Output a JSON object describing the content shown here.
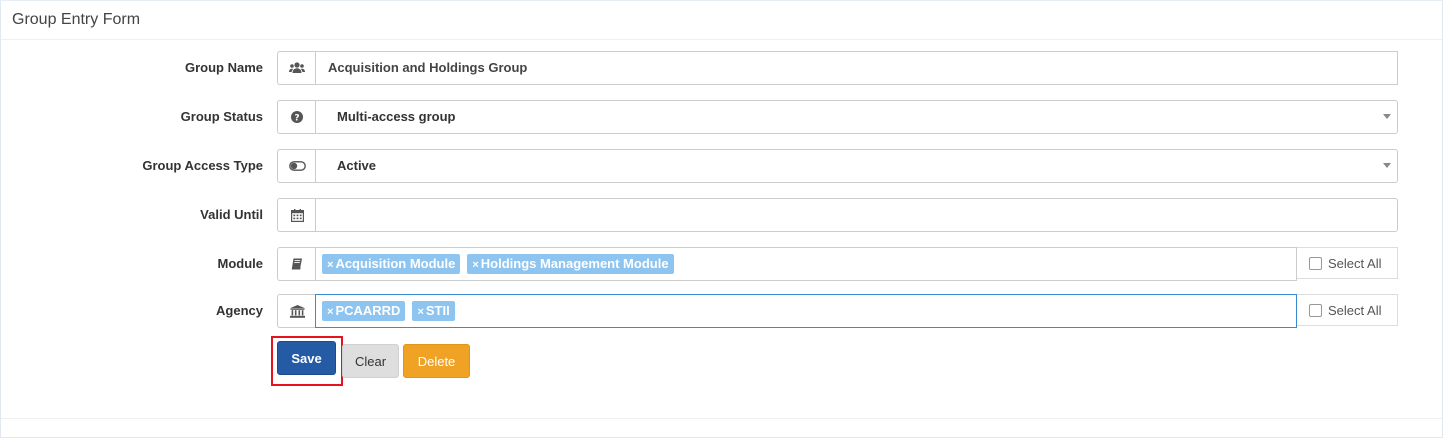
{
  "panel": {
    "title": "Group Entry Form"
  },
  "form": {
    "group_name": {
      "label": "Group Name",
      "icon": "users-icon",
      "value": "Acquisition and Holdings Group"
    },
    "group_status": {
      "label": "Group Status",
      "icon": "question-circle-icon",
      "value": "Multi-access group"
    },
    "group_access_type": {
      "label": "Group Access Type",
      "icon": "toggle-icon",
      "value": "Active"
    },
    "valid_until": {
      "label": "Valid Until",
      "icon": "calendar-icon",
      "value": ""
    },
    "module": {
      "label": "Module",
      "icon": "book-icon",
      "tags": [
        "Acquisition Module",
        "Holdings Management Module"
      ],
      "select_all": "Select All"
    },
    "agency": {
      "label": "Agency",
      "icon": "bank-icon",
      "tags": [
        "PCAARRD",
        "STII"
      ],
      "select_all": "Select All"
    }
  },
  "buttons": {
    "save": "Save",
    "clear": "Clear",
    "delete": "Delete"
  },
  "tag_remove_glyph": "×",
  "colors": {
    "save": "#245ba4",
    "delete": "#f0a224",
    "tag": "#8ec4f0",
    "highlight": "#e8121f"
  }
}
